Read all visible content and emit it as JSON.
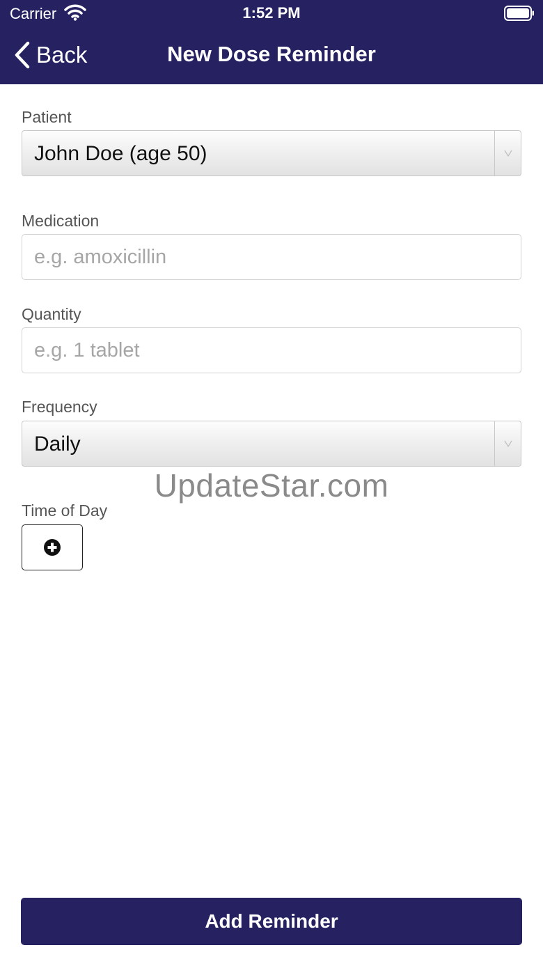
{
  "status_bar": {
    "carrier": "Carrier",
    "time": "1:52 PM",
    "icons": [
      "wifi-icon",
      "battery-icon"
    ]
  },
  "nav": {
    "back_label": "Back",
    "title": "New Dose Reminder",
    "background_color": "#262262"
  },
  "form": {
    "patient": {
      "label": "Patient",
      "selected_value": "John Doe (age 50)"
    },
    "medication": {
      "label": "Medication",
      "value": "",
      "placeholder": "e.g. amoxicillin"
    },
    "quantity": {
      "label": "Quantity",
      "value": "",
      "placeholder": "e.g. 1 tablet"
    },
    "frequency": {
      "label": "Frequency",
      "selected_value": "Daily"
    },
    "time_of_day": {
      "label": "Time of Day",
      "add_icon": "plus-circle-icon"
    }
  },
  "watermark": "UpdateStar.com",
  "actions": {
    "add_reminder_label": "Add Reminder",
    "button_color": "#262262"
  }
}
